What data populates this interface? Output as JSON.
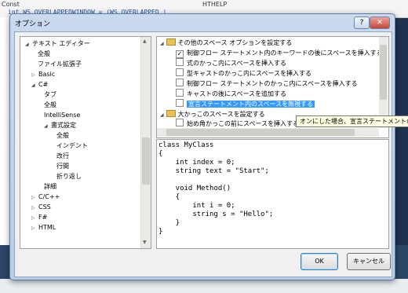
{
  "background": {
    "top_label": "Const",
    "code_fragment": "int  WS_OVERLAPPEDWINDOW = (WS_OVERLAPPED |",
    "right_label": "HTHELP"
  },
  "dialog": {
    "title": "オプション",
    "help_glyph": "?",
    "close_glyph": "✕"
  },
  "tree": {
    "items": [
      {
        "label": "テキスト エディター",
        "expanded": true
      },
      {
        "label": "全般"
      },
      {
        "label": "ファイル拡張子"
      },
      {
        "label": "Basic",
        "expanded": false
      },
      {
        "label": "C#",
        "expanded": true
      },
      {
        "label": "タブ"
      },
      {
        "label": "全般"
      },
      {
        "label": "IntelliSense"
      },
      {
        "label": "書式設定",
        "expanded": true
      },
      {
        "label": "全般"
      },
      {
        "label": "インデント"
      },
      {
        "label": "改行"
      },
      {
        "label": "行間"
      },
      {
        "label": "折り返し"
      },
      {
        "label": "詳細"
      },
      {
        "label": "C/C++",
        "expanded": false
      },
      {
        "label": "CSS",
        "expanded": false
      },
      {
        "label": "F#",
        "expanded": false
      },
      {
        "label": "HTML",
        "expanded": false
      }
    ]
  },
  "options": {
    "group1_label": "その他のスペース オプションを設定する",
    "items": [
      {
        "label": "制御フロー ステートメント内のキーワードの後にスペースを挿入する",
        "checked": true
      },
      {
        "label": "式のかっこ内にスペースを挿入する",
        "checked": false
      },
      {
        "label": "型キャストのかっこ内にスペースを挿入する",
        "checked": false
      },
      {
        "label": "制御フロー ステートメントのかっこ内にスペースを挿入する",
        "checked": false
      },
      {
        "label": "キャストの後にスペースを追加する",
        "checked": false
      },
      {
        "label": "宣言ステートメント内のスペースを無視する",
        "checked": false,
        "selected": true
      }
    ],
    "group2_label": "大かっこのスペースを設定する",
    "group2_items": [
      {
        "label": "始め角かっこの前にスペースを挿入する",
        "checked": false
      }
    ],
    "tooltip": "オンにした場合、宣言ステートメントの前"
  },
  "preview": {
    "lines": [
      "class MyClass",
      "{",
      "    int index = 0;",
      "    string text = \"Start\";",
      "",
      "    void Method()",
      "    {",
      "        int i = 0;",
      "        string s = \"Hello\";",
      "    }",
      "}"
    ]
  },
  "buttons": {
    "ok": "OK",
    "cancel": "キャンセル"
  }
}
